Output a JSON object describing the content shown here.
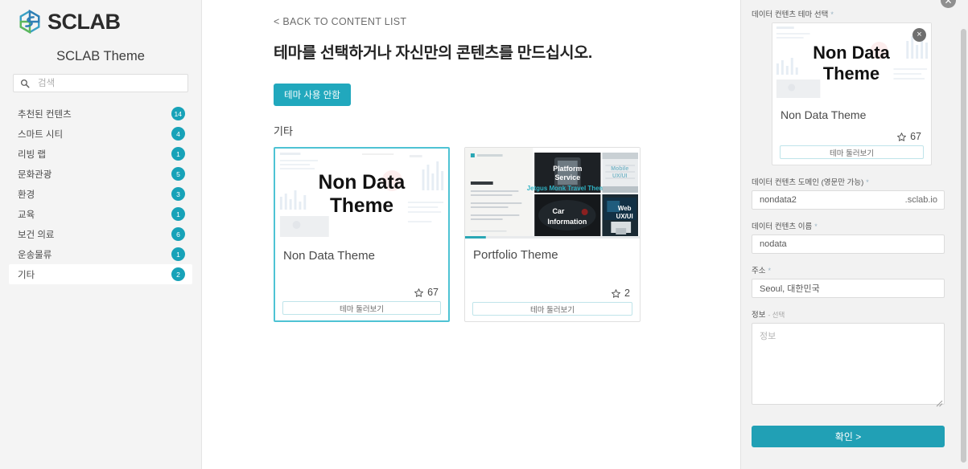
{
  "brand": {
    "name": "SCLAB",
    "logo_icon": "sclab-hex-logo"
  },
  "sidebar": {
    "title": "SCLAB Theme",
    "search": {
      "placeholder": "검색",
      "value": "",
      "icon": "search-icon"
    },
    "items": [
      {
        "label": "추천된 컨텐츠",
        "count": "14",
        "selected": false
      },
      {
        "label": "스마트 시티",
        "count": "4",
        "selected": false
      },
      {
        "label": "리빙 랩",
        "count": "1",
        "selected": false
      },
      {
        "label": "문화관광",
        "count": "5",
        "selected": false
      },
      {
        "label": "환경",
        "count": "3",
        "selected": false
      },
      {
        "label": "교육",
        "count": "1",
        "selected": false
      },
      {
        "label": "보건 의료",
        "count": "6",
        "selected": false
      },
      {
        "label": "운송물류",
        "count": "1",
        "selected": false
      },
      {
        "label": "기타",
        "count": "2",
        "selected": true
      }
    ]
  },
  "main": {
    "back_link": "< BACK TO CONTENT LIST",
    "heading": "테마를 선택하거나 자신만의 콘텐츠를 만드십시오.",
    "no_theme_button": "테마 사용 안함",
    "section_label": "기타",
    "cards": [
      {
        "title": "Non Data Theme",
        "thumb_title": "Non Data Theme",
        "thumb_kind": "non-data",
        "rating": "67",
        "star_icon": "star-outline-icon",
        "preview_button": "테마 둘러보기",
        "selected": true
      },
      {
        "title": "Portfolio Theme",
        "thumb_kind": "portfolio",
        "thumb_tiles": [
          "Platform Service",
          "Mobile UX/UI",
          "Car Information",
          "Web UX/UI"
        ],
        "thumb_heading": "who we are",
        "thumb_caption": "Jetgus Monk Travel Theme",
        "rating": "2",
        "star_icon": "star-outline-icon",
        "preview_button": "테마 둘러보기",
        "selected": false
      }
    ]
  },
  "right_panel": {
    "close_icon": "close-circle-icon",
    "theme_select": {
      "label": "데이터 컨텐츠 테마 선택",
      "required_mark": "*",
      "card": {
        "title": "Non Data Theme",
        "thumb_title": "Non Data Theme",
        "rating": "67",
        "star_icon": "star-outline-icon",
        "preview_button": "테마 둘러보기",
        "remove_icon": "close-circle-icon",
        "remove_label": "×"
      }
    },
    "fields": [
      {
        "label": "데이터 컨텐츠 도메인 (영문만 가능)",
        "required_mark": "*",
        "value": "nondata2",
        "placeholder": "",
        "suffix": ".sclab.io",
        "type": "text"
      },
      {
        "label": "데이터 컨텐츠 이름",
        "required_mark": "*",
        "value": "nodata",
        "placeholder": "",
        "suffix": "",
        "type": "text"
      },
      {
        "label": "주소",
        "required_mark": "*",
        "value": "Seoul, 대한민국",
        "placeholder": "",
        "suffix": "",
        "type": "text"
      },
      {
        "label": "정보",
        "optional_mark": "- 선택",
        "value": "",
        "placeholder": "정보",
        "suffix": "",
        "type": "textarea"
      }
    ],
    "confirm_button": "확인 >"
  },
  "colors": {
    "accent_teal": "#21a8bd",
    "badge_teal": "#17a2b8",
    "selected_border": "#4ec3d4",
    "sidebar_bg": "#f4f4f4",
    "panel_bg": "#f2f2f2"
  }
}
